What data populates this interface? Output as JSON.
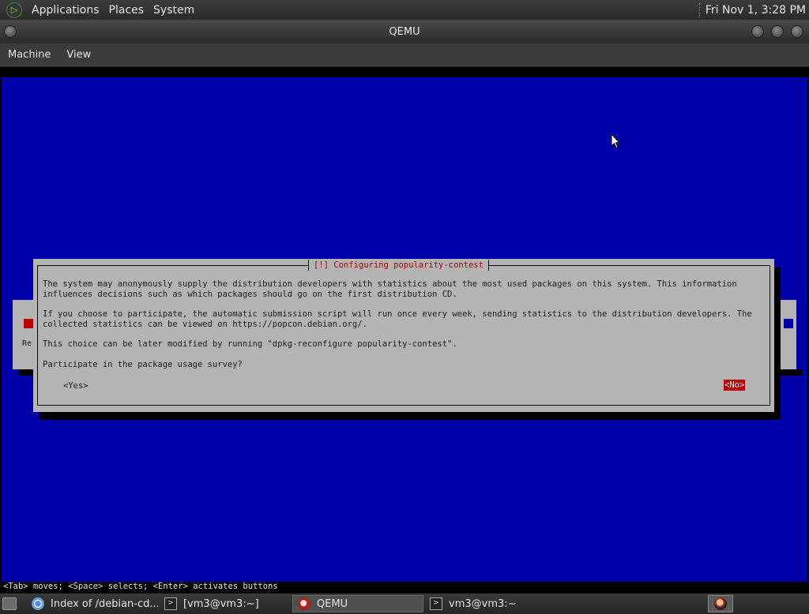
{
  "top_panel": {
    "menus": [
      "Applications",
      "Places",
      "System"
    ],
    "clock": "Fri Nov 1,  3:28 PM"
  },
  "window": {
    "title": "QEMU",
    "menus": [
      "Machine",
      "View"
    ]
  },
  "installer": {
    "dialog_title": "[!] Configuring popularity-contest",
    "paragraph1": "The system may anonymously supply the distribution developers with statistics about the most used packages on this system. This information\ninfluences decisions such as which packages should go on the first distribution CD.",
    "paragraph2": "If you choose to participate, the automatic submission script will run once every week, sending statistics to the distribution developers. The\ncollected statistics can be viewed on https://popcon.debian.org/.",
    "paragraph3": "This choice can be later modified by running \"dpkg-reconfigure popularity-contest\".",
    "question": "Participate in the package usage survey?",
    "yes_label": "<Yes>",
    "no_label": "<No>",
    "bg_partial_label": "Re",
    "hint": "<Tab> moves; <Space> selects; <Enter> activates buttons"
  },
  "taskbar": {
    "tasks": [
      {
        "label": "Index of /debian-cd...",
        "icon": "chrome-icon"
      },
      {
        "label": "[vm3@vm3:~]",
        "icon": "terminal-icon"
      },
      {
        "label": "QEMU",
        "icon": "qemu-icon",
        "active": true
      },
      {
        "label": "vm3@vm3:~",
        "icon": "terminal-icon"
      }
    ]
  },
  "colors": {
    "installer_background": "#0000a8",
    "dialog_background": "#b4b4b4",
    "accent_red": "#c00000"
  }
}
